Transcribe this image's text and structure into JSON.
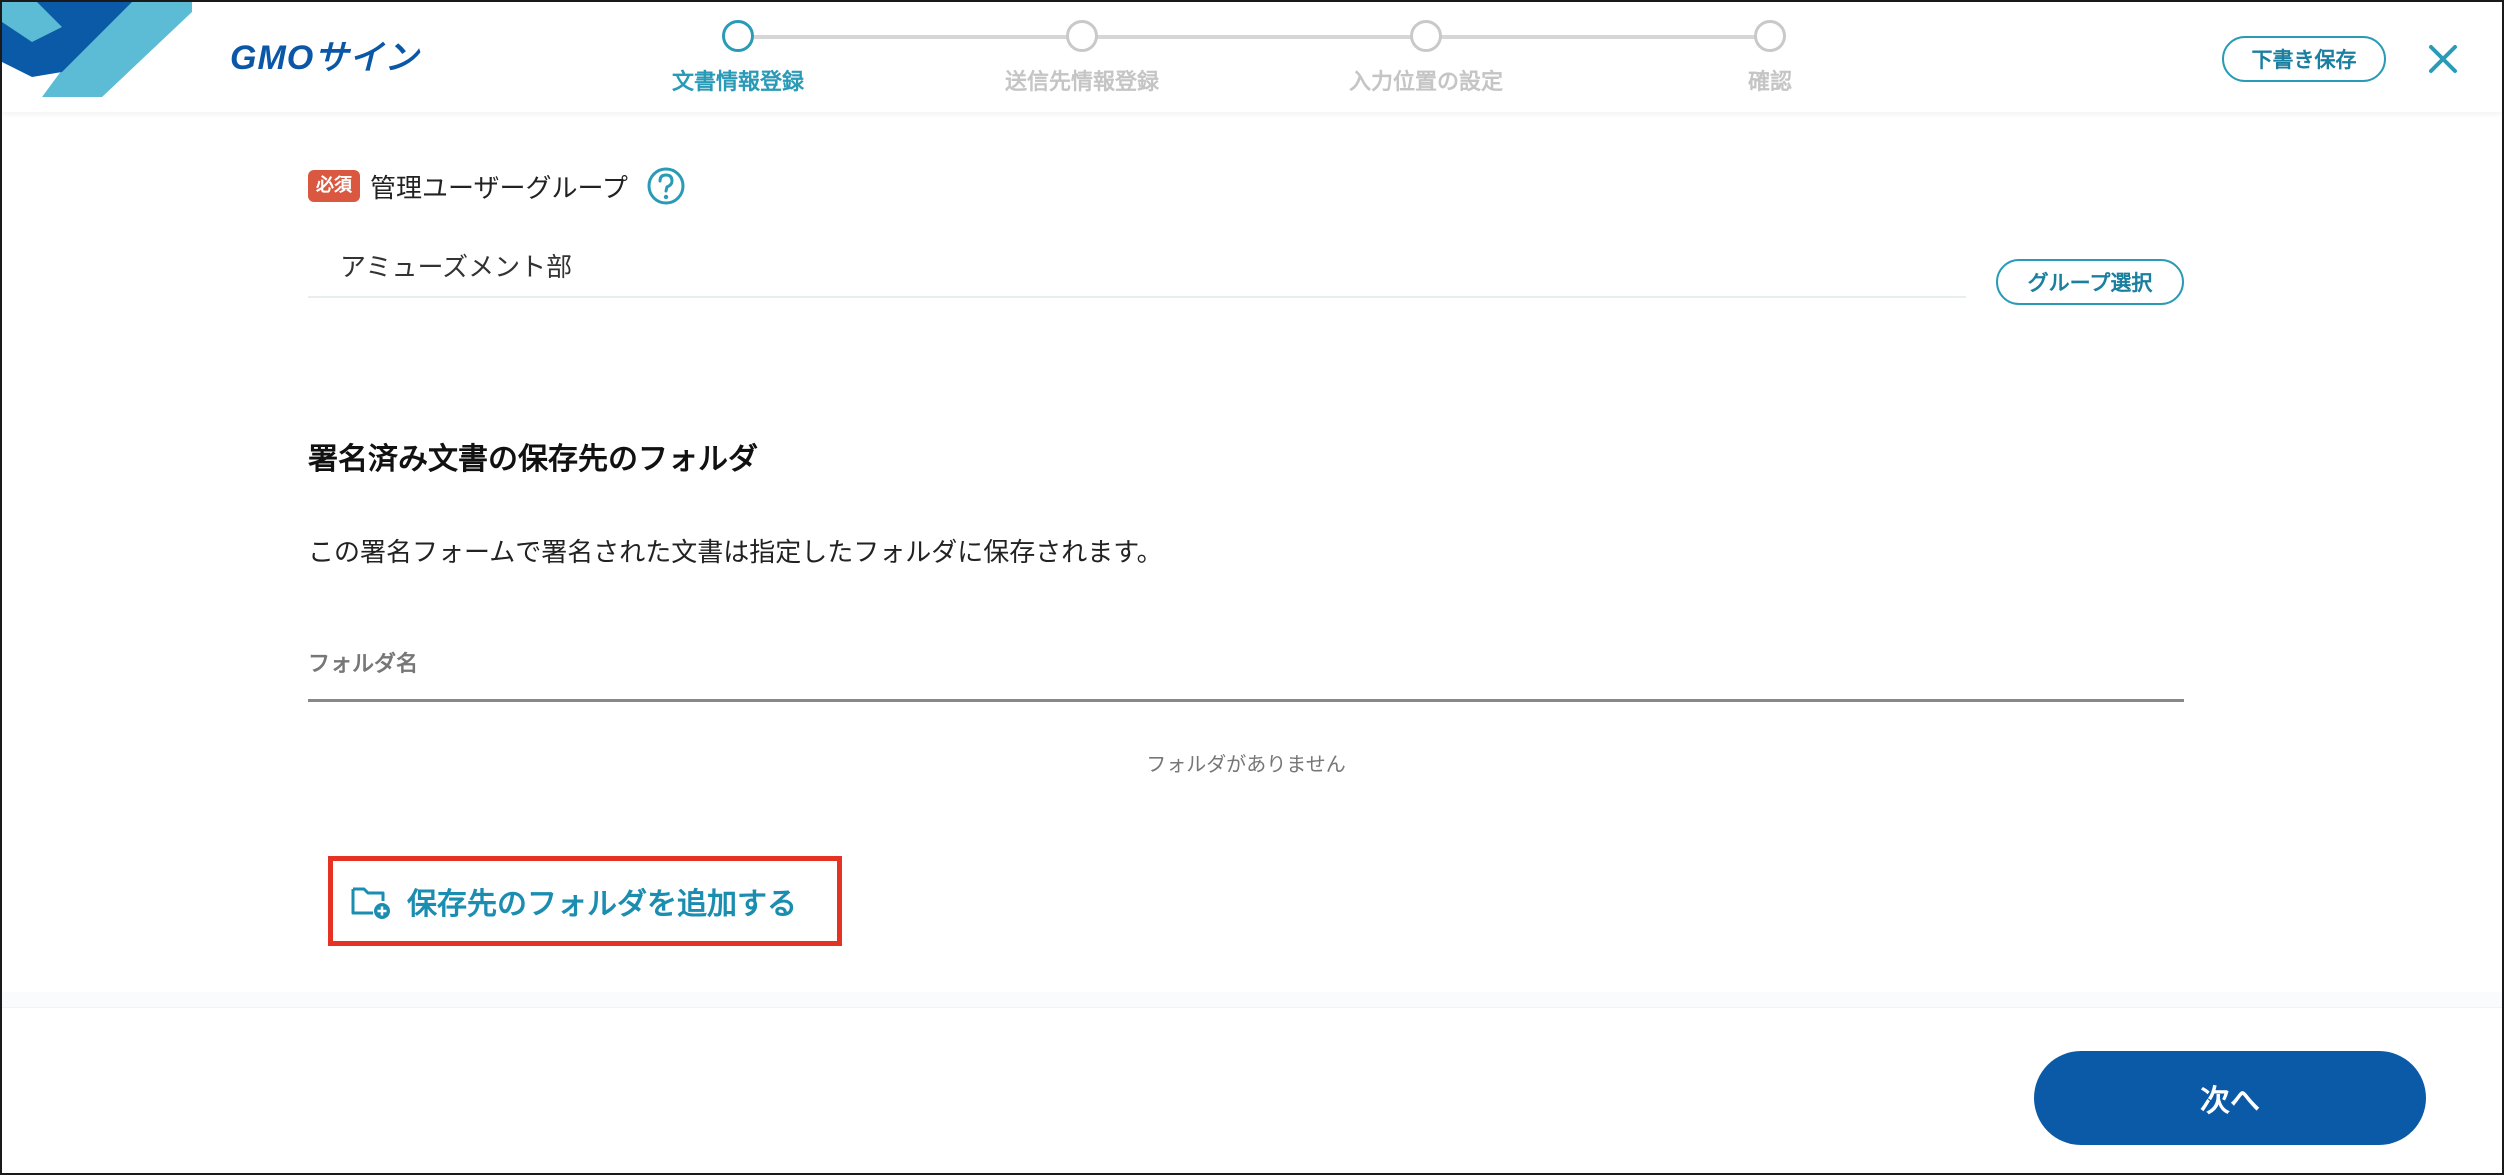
{
  "header": {
    "logo_text": "GMOサイン",
    "steps": [
      {
        "label": "文書情報登録",
        "active": true
      },
      {
        "label": "送信先情報登録",
        "active": false
      },
      {
        "label": "入力位置の設定",
        "active": false
      },
      {
        "label": "確認",
        "active": false
      }
    ],
    "draft_save_label": "下書き保存"
  },
  "group": {
    "required_badge": "必須",
    "label": "管理ユーザーグループ",
    "value": "アミューズメント部",
    "select_button_label": "グループ選択"
  },
  "folder_section": {
    "title": "署名済み文書の保存先のフォルダ",
    "description": "この署名フォームで署名された文書は指定したフォルダに保存されます。",
    "column_header": "フォルダ名",
    "empty_message": "フォルダがありません",
    "add_button_label": "保存先のフォルダを追加する"
  },
  "footer": {
    "next_label": "次へ"
  },
  "colors": {
    "brand_blue": "#0b5aa8",
    "accent_teal": "#2a9bb7",
    "required_red": "#d9583f",
    "highlight_red": "#e53222"
  },
  "icons": {
    "close": "close-icon",
    "help": "help-icon",
    "folder_add": "folder-add-icon"
  }
}
